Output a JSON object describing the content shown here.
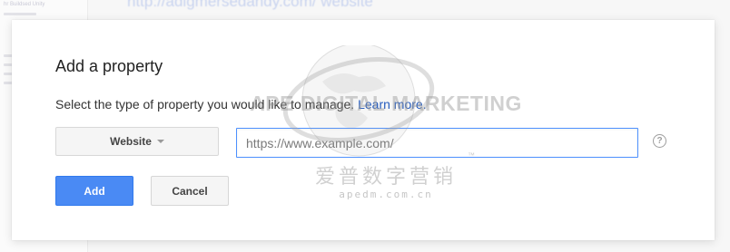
{
  "background": {
    "url_text": "http://adigmersedandy.com/  website",
    "sidebar_text": "hr Buildsed Unity"
  },
  "dialog": {
    "title": "Add a property",
    "instruction": "Select the type of property you would like to manage.",
    "learn_more_label": "Learn more.",
    "property_type": {
      "selected": "Website"
    },
    "url_field": {
      "value": "",
      "placeholder": "https://www.example.com/"
    },
    "help_icon": "?",
    "add_label": "Add",
    "cancel_label": "Cancel"
  },
  "watermark": {
    "english": "APE DIGITAL MARKETING",
    "tm": "™",
    "chinese": "爱普数字营销",
    "url": "apedm.com.cn"
  },
  "colors": {
    "primary_button": "#4a8af4",
    "link": "#1a56c2",
    "input_focus_border": "#4d90fe"
  }
}
